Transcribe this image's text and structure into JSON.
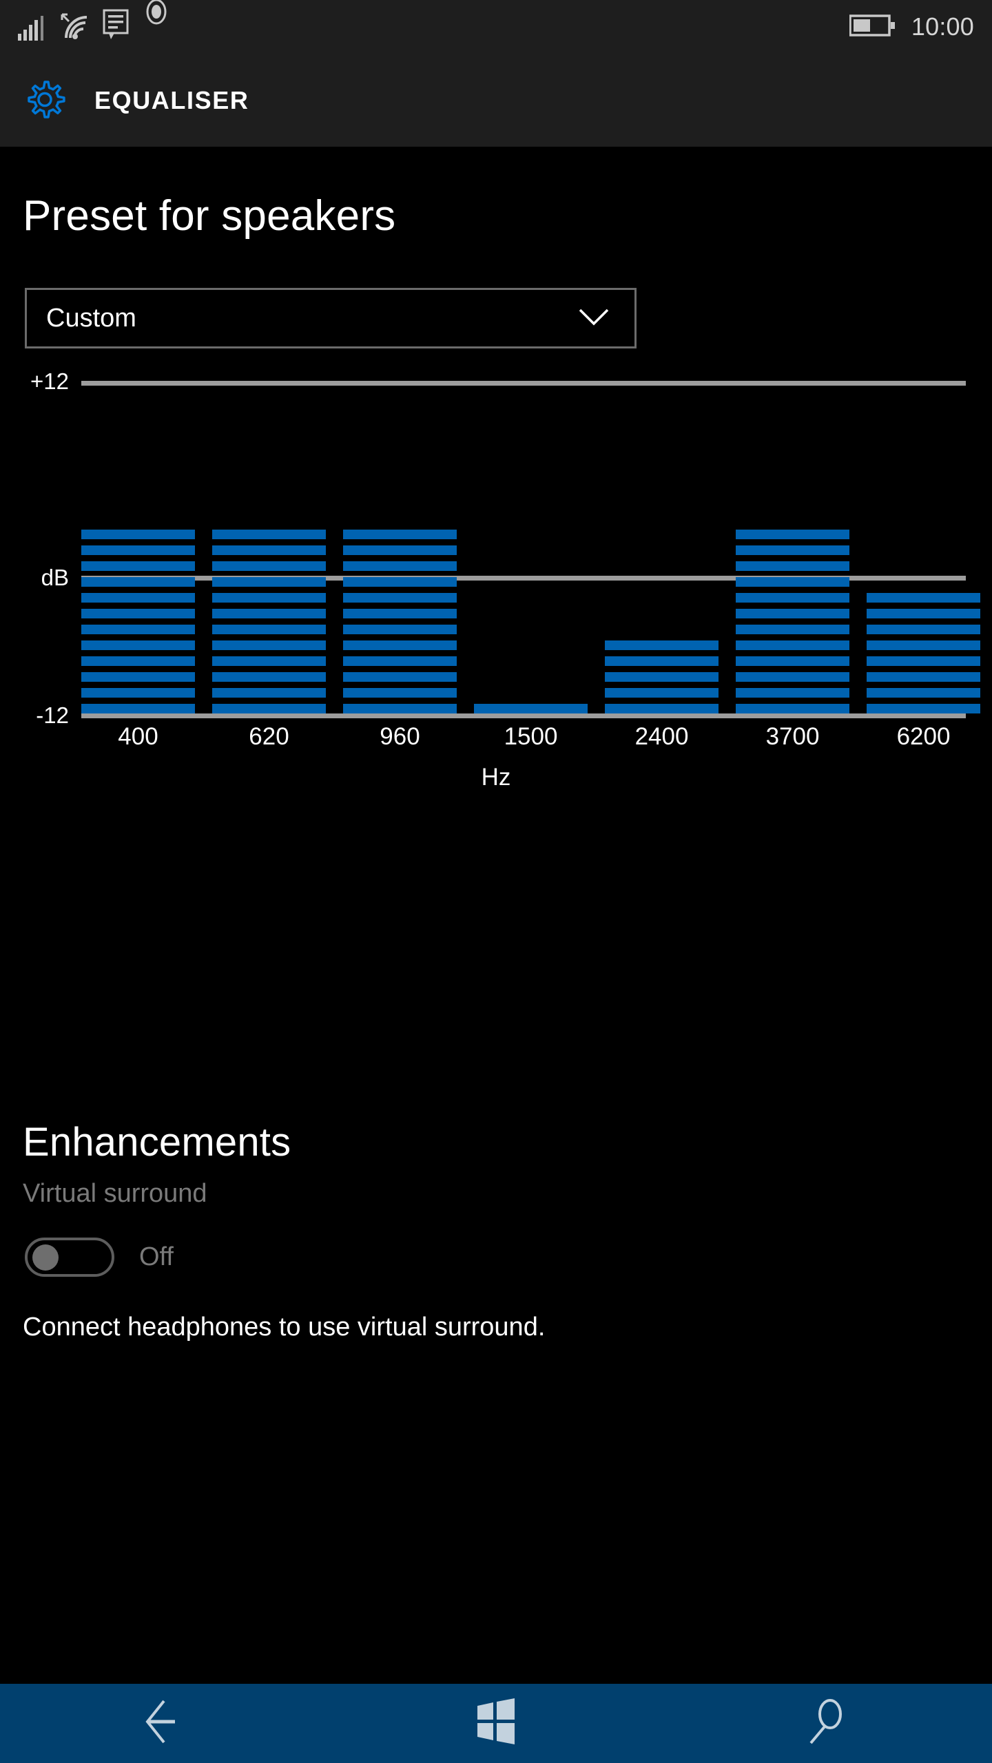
{
  "statusbar": {
    "time": "10:00",
    "icons": [
      "cellular-signal-icon",
      "wifi-icon",
      "sms-icon",
      "recording-icon",
      "battery-icon"
    ],
    "battery_level_pct": 50
  },
  "appbar": {
    "title": "EQUALISER",
    "icon": "gear-icon",
    "icon_color": "#0078d7"
  },
  "page": {
    "title": "Preset for speakers"
  },
  "preset_select": {
    "value": "Custom",
    "chevron": "chevron-down-icon"
  },
  "chart_data": {
    "type": "bar",
    "title": "",
    "xlabel": "Hz",
    "ylabel": "dB",
    "categories": [
      "400",
      "620",
      "960",
      "1500",
      "2400",
      "3700",
      "6200"
    ],
    "values": [
      0,
      0,
      0,
      -11,
      -7,
      0,
      -4
    ],
    "segments": [
      12,
      12,
      12,
      1,
      5,
      12,
      8
    ],
    "segment_max": 12,
    "ylim": [
      -12,
      12
    ],
    "ytick_labels": [
      "+12",
      "dB",
      "-12"
    ],
    "grid": true,
    "legend": "none",
    "bar_color": "#0063b1",
    "grid_color": "#9d9d9d"
  },
  "enhancements": {
    "title": "Enhancements",
    "subtitle": "Virtual surround",
    "toggle_state": "Off",
    "note": "Connect headphones to use virtual surround."
  },
  "navbar": {
    "back": "back-arrow-icon",
    "home": "windows-start-icon",
    "search": "search-icon",
    "color": "#01406e"
  }
}
